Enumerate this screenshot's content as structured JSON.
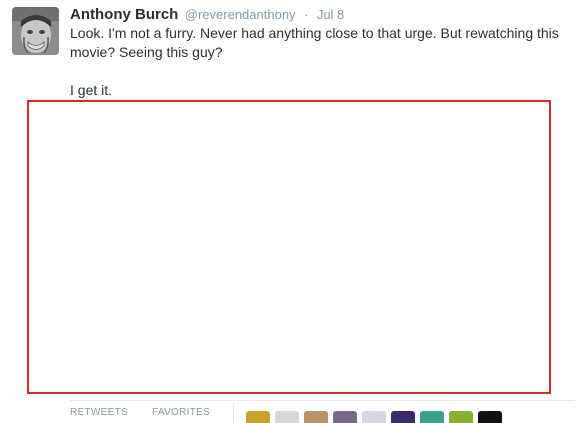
{
  "tweet": {
    "author_name": "Anthony Burch",
    "author_handle": "@reverendanthony",
    "separator": "·",
    "date": "Jul 8",
    "text_line1": "Look. I'm not a furry. Never had anything close to that urge. But rewatching this movie? Seeing this guy?",
    "text_line2": "I get it."
  },
  "stats": {
    "retweets_label": "RETWEETS",
    "favorites_label": "FAVORITES"
  },
  "favoriters": [
    {
      "icon": "avatar-yellow-dark",
      "color": "#c8a22a"
    },
    {
      "icon": "avatar-light-grey",
      "color": "#d8d8d8"
    },
    {
      "icon": "avatar-tan",
      "color": "#b8926a"
    },
    {
      "icon": "avatar-purple-grey",
      "color": "#7a6a8a"
    },
    {
      "icon": "avatar-white-grey",
      "color": "#d6d6e0"
    },
    {
      "icon": "avatar-dark-purple",
      "color": "#3a2a6a"
    },
    {
      "icon": "avatar-teal",
      "color": "#3aa08a"
    },
    {
      "icon": "avatar-green-yellow",
      "color": "#8ab030"
    },
    {
      "icon": "avatar-black",
      "color": "#111111"
    }
  ],
  "colors": {
    "highlight_border": "#d52a2a",
    "name_text": "#292f33",
    "meta_text": "#8899a6"
  }
}
